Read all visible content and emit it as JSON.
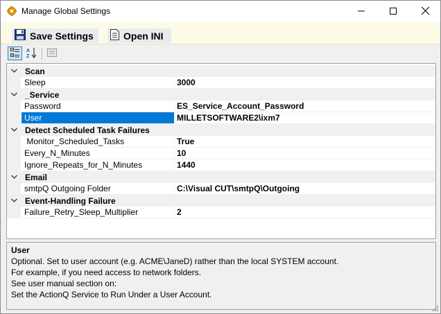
{
  "window": {
    "title": "Manage Global Settings"
  },
  "toolbar": {
    "save_label": "Save Settings",
    "open_label": "Open INI"
  },
  "grid": {
    "categories": [
      {
        "name": "Scan",
        "properties": [
          {
            "name": "Sleep",
            "value": "3000"
          }
        ]
      },
      {
        "name": "_Service",
        "properties": [
          {
            "name": "Password",
            "value": "ES_Service_Account_Password"
          },
          {
            "name": "User",
            "value": "MILLETSOFTWARE2\\ixm7",
            "selected": true
          }
        ]
      },
      {
        "name": "Detect Scheduled Task Failures",
        "properties": [
          {
            "name": " Monitor_Scheduled_Tasks",
            "value": "True"
          },
          {
            "name": "Every_N_Minutes",
            "value": "10"
          },
          {
            "name": "Ignore_Repeats_for_N_Minutes",
            "value": "1440"
          }
        ]
      },
      {
        "name": "Email",
        "properties": [
          {
            "name": "smtpQ Outgoing Folder",
            "value": "C:\\Visual CUT\\smtpQ\\Outgoing"
          }
        ]
      },
      {
        "name": "Event-Handling Failure",
        "properties": [
          {
            "name": "Failure_Retry_Sleep_Multiplier",
            "value": "2"
          }
        ]
      }
    ]
  },
  "help": {
    "title": "User",
    "lines": [
      "Optional. Set to user account (e.g. ACME\\JaneD) rather than the local SYSTEM account.",
      "For example, if you need access to network folders.",
      "See user manual section on:",
      "Set the ActionQ Service to Run Under a User Account."
    ]
  },
  "colors": {
    "selection": "#0078d7",
    "toolbar_bg": "#fdfbe6",
    "category_bg": "#f0f0f0"
  },
  "icons": {
    "app": "gear-icon",
    "save": "floppy-disk-icon",
    "open": "document-icon",
    "categorized": "categorized-view-icon",
    "alphabetical": "sort-az-icon",
    "property_pages": "property-pages-icon"
  }
}
